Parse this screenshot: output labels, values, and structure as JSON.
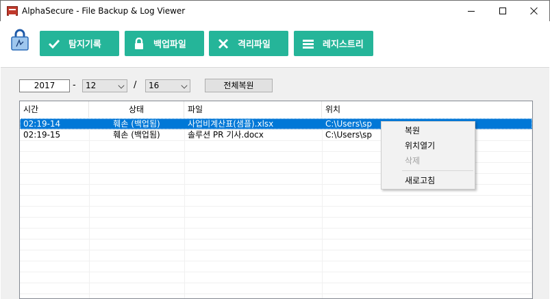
{
  "window": {
    "title": "AlphaSecure - File Backup & Log Viewer",
    "app_icon": "alphasecure-app-icon"
  },
  "toolbar": {
    "logo_icon": "padlock-icon",
    "buttons": [
      {
        "label": "탐지기록",
        "icon": "check-icon"
      },
      {
        "label": "백업파일",
        "icon": "lock-icon"
      },
      {
        "label": "격리파일",
        "icon": "x-icon"
      },
      {
        "label": "레지스트리",
        "icon": "menu-lines-icon"
      }
    ],
    "accent_color": "#25b599"
  },
  "filter": {
    "year": "2017",
    "separator1": "-",
    "month": "12",
    "separator2": "/",
    "day": "16",
    "restore_all_label": "전체복원"
  },
  "list": {
    "columns": [
      "시간",
      "상태",
      "파일",
      "위치"
    ],
    "rows": [
      {
        "time": "02:19-14",
        "status": "훼손 (백업됨)",
        "file": "사업비계산표(샘플).xlsx",
        "location": "C:\\Users\\sp",
        "selected": true
      },
      {
        "time": "02:19-15",
        "status": "훼손 (백업됨)",
        "file": "솔루션 PR 기사.docx",
        "location": "C:\\Users\\sp",
        "selected": false
      }
    ],
    "selection_color": "#0078d7"
  },
  "context_menu": {
    "items": [
      {
        "label": "복원",
        "disabled": false
      },
      {
        "label": "위치열기",
        "disabled": false
      },
      {
        "label": "삭제",
        "disabled": true
      },
      {
        "label": "새로고침",
        "disabled": false
      }
    ]
  }
}
